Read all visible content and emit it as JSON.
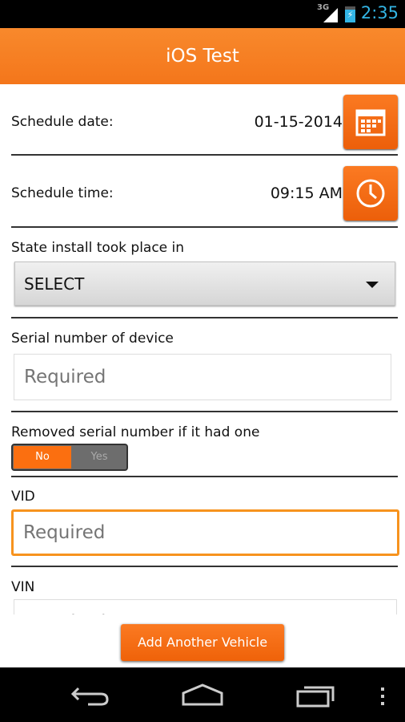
{
  "status_bar": {
    "network": "3G",
    "time": "2:35",
    "icons": [
      "signal-icon",
      "battery-charging-icon"
    ]
  },
  "header": {
    "title": "iOS Test"
  },
  "form": {
    "schedule_date": {
      "label": "Schedule date:",
      "value": "01-15-2014",
      "icon": "calendar-icon"
    },
    "schedule_time": {
      "label": "Schedule time:",
      "value": "09:15 AM",
      "icon": "clock-icon"
    },
    "state": {
      "label": "State install took place in",
      "selected": "SELECT"
    },
    "serial": {
      "label": "Serial number of device",
      "placeholder": "Required"
    },
    "removed_serial": {
      "label": "Removed serial number if it had one",
      "options": [
        "No",
        "Yes"
      ],
      "selected": "No"
    },
    "vid": {
      "label": "VID",
      "placeholder": "Required"
    },
    "vin": {
      "label": "VIN",
      "placeholder": "Required"
    }
  },
  "add_button": "Add Another Vehicle",
  "accent": "#f47a20",
  "nav_bar": {
    "icons": [
      "back-icon",
      "home-icon",
      "recent-apps-icon",
      "menu-icon"
    ]
  }
}
